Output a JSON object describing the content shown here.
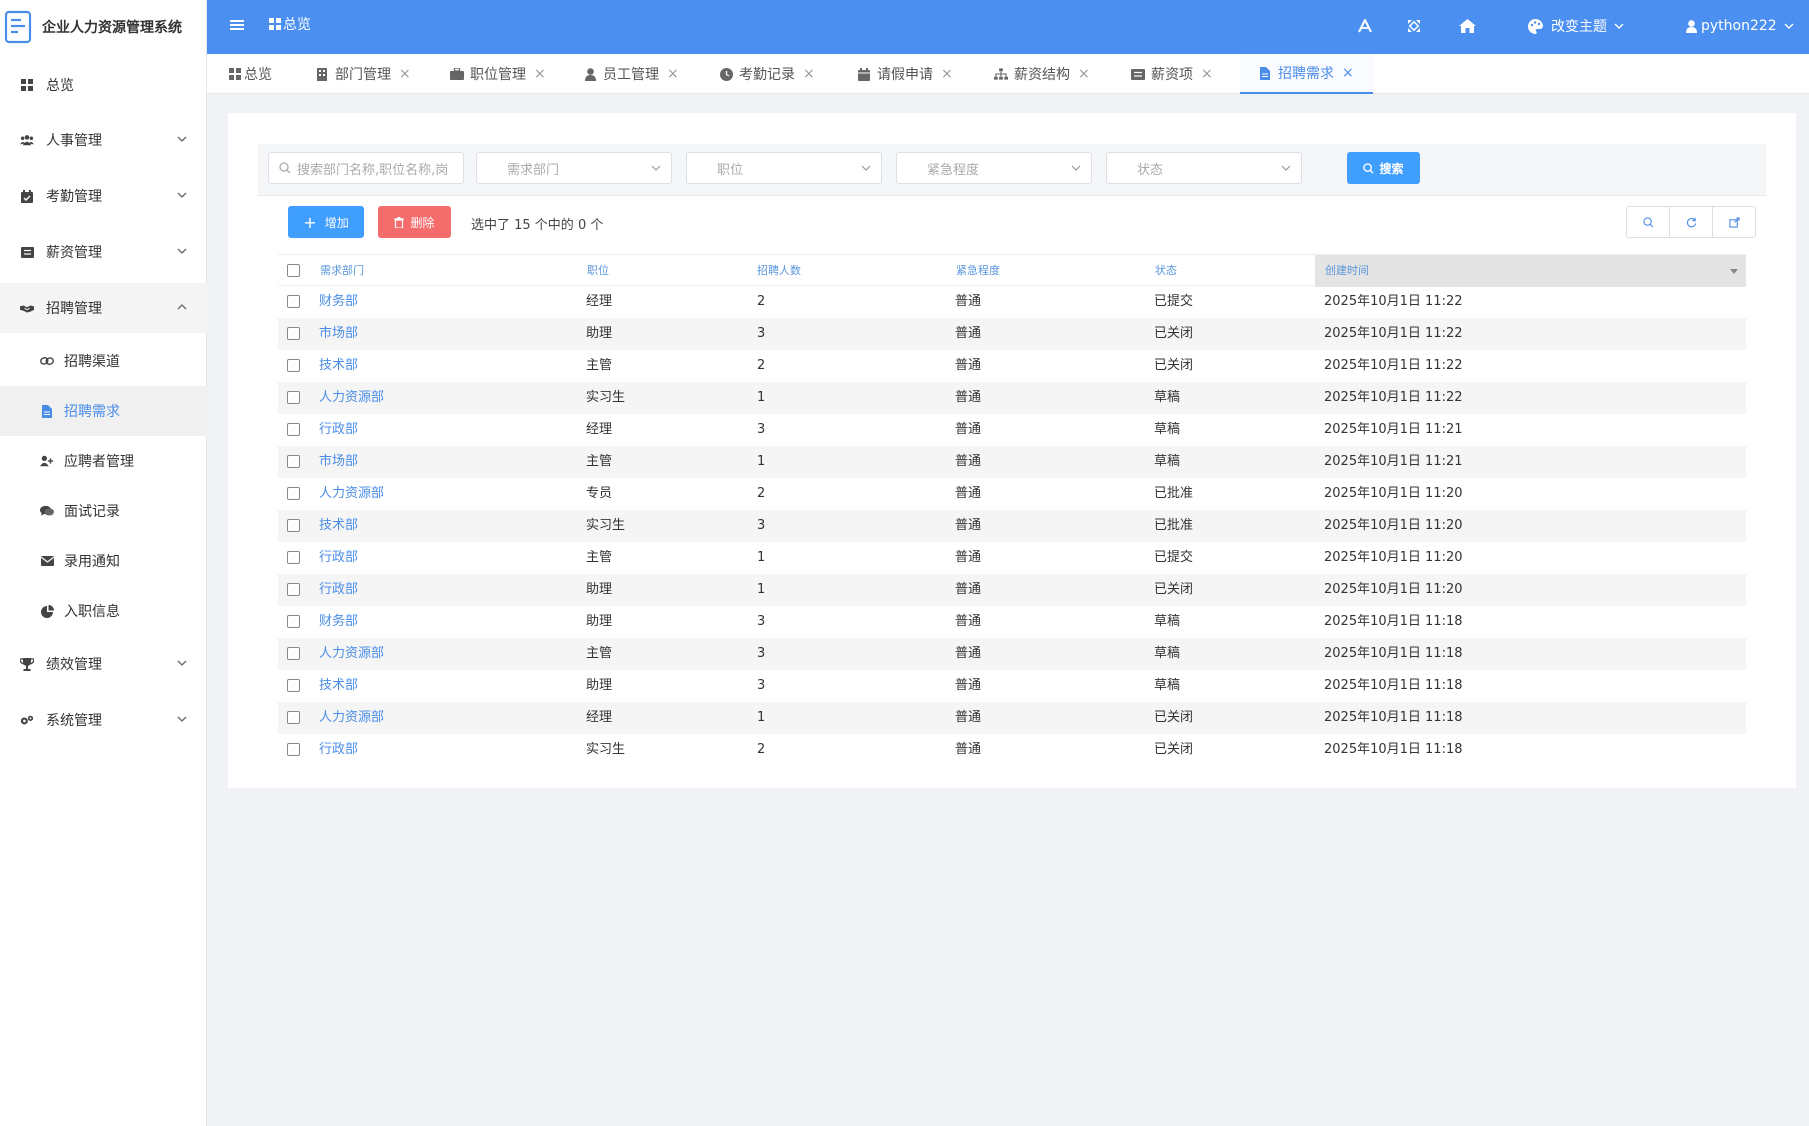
{
  "app": {
    "title": "企业人力资源管理系统"
  },
  "topbar": {
    "breadcrumb": "总览",
    "theme_label": "改变主题",
    "user_label": "python222"
  },
  "sidebar": {
    "items": [
      {
        "label": "总览",
        "icon": "dashboard-icon"
      },
      {
        "label": "人事管理",
        "icon": "users-icon"
      },
      {
        "label": "考勤管理",
        "icon": "calendar-check-icon"
      },
      {
        "label": "薪资管理",
        "icon": "list-icon"
      },
      {
        "label": "招聘管理",
        "icon": "handshake-icon"
      },
      {
        "label": "绩效管理",
        "icon": "trophy-icon"
      },
      {
        "label": "系统管理",
        "icon": "gears-icon"
      }
    ],
    "sub_items": [
      {
        "label": "招聘渠道",
        "icon": "link-icon"
      },
      {
        "label": "招聘需求",
        "icon": "file-icon"
      },
      {
        "label": "应聘者管理",
        "icon": "user-plus-icon"
      },
      {
        "label": "面试记录",
        "icon": "comments-icon"
      },
      {
        "label": "录用通知",
        "icon": "envelope-icon"
      },
      {
        "label": "入职信息",
        "icon": "pie-chart-icon"
      }
    ]
  },
  "tabs": [
    {
      "label": "总览",
      "icon": "dashboard-icon"
    },
    {
      "label": "部门管理",
      "icon": "building-icon"
    },
    {
      "label": "职位管理",
      "icon": "briefcase-icon"
    },
    {
      "label": "员工管理",
      "icon": "user-icon"
    },
    {
      "label": "考勤记录",
      "icon": "clock-icon"
    },
    {
      "label": "请假申请",
      "icon": "calendar-icon"
    },
    {
      "label": "薪资结构",
      "icon": "sitemap-icon"
    },
    {
      "label": "薪资项",
      "icon": "list-icon"
    },
    {
      "label": "招聘需求",
      "icon": "file-icon"
    }
  ],
  "filters": {
    "search_placeholder": "搜索部门名称,职位名称,岗",
    "department_placeholder": "需求部门",
    "position_placeholder": "职位",
    "urgency_placeholder": "紧急程度",
    "status_placeholder": "状态",
    "search_button": "搜索"
  },
  "actions": {
    "add_label": "增加",
    "delete_label": "删除",
    "selection_info": "选中了 15 个中的 0 个"
  },
  "table": {
    "headers": [
      "需求部门",
      "职位",
      "招聘人数",
      "紧急程度",
      "状态",
      "创建时间"
    ],
    "rows": [
      [
        "财务部",
        "经理",
        "2",
        "普通",
        "已提交",
        "2025年10月1日 11:22"
      ],
      [
        "市场部",
        "助理",
        "3",
        "普通",
        "已关闭",
        "2025年10月1日 11:22"
      ],
      [
        "技术部",
        "主管",
        "2",
        "普通",
        "已关闭",
        "2025年10月1日 11:22"
      ],
      [
        "人力资源部",
        "实习生",
        "1",
        "普通",
        "草稿",
        "2025年10月1日 11:22"
      ],
      [
        "行政部",
        "经理",
        "3",
        "普通",
        "草稿",
        "2025年10月1日 11:21"
      ],
      [
        "市场部",
        "主管",
        "1",
        "普通",
        "草稿",
        "2025年10月1日 11:21"
      ],
      [
        "人力资源部",
        "专员",
        "2",
        "普通",
        "已批准",
        "2025年10月1日 11:20"
      ],
      [
        "技术部",
        "实习生",
        "3",
        "普通",
        "已批准",
        "2025年10月1日 11:20"
      ],
      [
        "行政部",
        "主管",
        "1",
        "普通",
        "已提交",
        "2025年10月1日 11:20"
      ],
      [
        "行政部",
        "助理",
        "1",
        "普通",
        "已关闭",
        "2025年10月1日 11:20"
      ],
      [
        "财务部",
        "助理",
        "3",
        "普通",
        "草稿",
        "2025年10月1日 11:18"
      ],
      [
        "人力资源部",
        "主管",
        "3",
        "普通",
        "草稿",
        "2025年10月1日 11:18"
      ],
      [
        "技术部",
        "助理",
        "3",
        "普通",
        "草稿",
        "2025年10月1日 11:18"
      ],
      [
        "人力资源部",
        "经理",
        "1",
        "普通",
        "已关闭",
        "2025年10月1日 11:18"
      ],
      [
        "行政部",
        "实习生",
        "2",
        "普通",
        "已关闭",
        "2025年10月1日 11:18"
      ]
    ]
  },
  "colors": {
    "primary": "#4b8ff0",
    "button_blue": "#409eff",
    "danger": "#f56c6c",
    "link": "#4a8de8"
  }
}
